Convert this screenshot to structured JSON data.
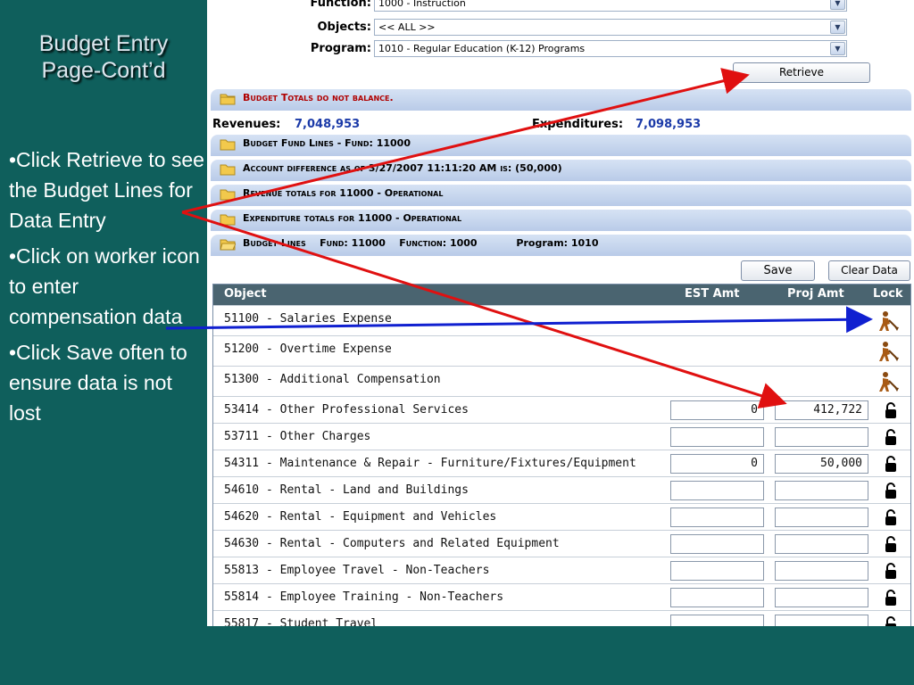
{
  "slide": {
    "title_line1": "Budget Entry",
    "title_line2": "Page-Cont’d",
    "bullets": [
      "•Click Retrieve to see the Budget Lines for Data Entry",
      "•Click on worker icon to enter compensation data",
      "•Click Save often to ensure data is not lost"
    ]
  },
  "filters": {
    "function": {
      "label": "Function:",
      "value": "1000 - Instruction"
    },
    "objects": {
      "label": "Objects:",
      "value": "<< ALL >>"
    },
    "program": {
      "label": "Program:",
      "value": "1010 - Regular Education (K-12) Programs"
    }
  },
  "buttons": {
    "retrieve": "Retrieve",
    "save": "Save",
    "clear_data": "Clear Data"
  },
  "sections": {
    "warning": "Budget Totals do not balance.",
    "fund_lines": "Budget Fund Lines - Fund: 11000",
    "account_difference": "Account difference as of 3/27/2007 11:11:20 AM is: (50,000)",
    "revenue_totals": "Revenue totals for 11000 - Operational",
    "expenditure_totals": "Expenditure totals for 11000 - Operational",
    "budget_lines": "Budget Lines    Fund: 11000    Function: 1000",
    "budget_lines_program": "Program: 1010"
  },
  "totals": {
    "revenues_label": "Revenues:",
    "revenues_value": "7,048,953",
    "expenditures_label": "Expenditures:",
    "expenditures_value": "7,098,953"
  },
  "table": {
    "headers": {
      "object": "Object",
      "est": "EST Amt",
      "proj": "Proj Amt",
      "lock": "Lock"
    },
    "rows": [
      {
        "object": "51100 - Salaries Expense",
        "type": "worker"
      },
      {
        "object": "51200 - Overtime Expense",
        "type": "worker"
      },
      {
        "object": "51300 - Additional Compensation",
        "type": "worker"
      },
      {
        "object": "53414 - Other Professional Services",
        "type": "input",
        "est": "0",
        "proj": "412,722"
      },
      {
        "object": "53711 - Other Charges",
        "type": "input",
        "est": "",
        "proj": ""
      },
      {
        "object": "54311 - Maintenance & Repair - Furniture/Fixtures/Equipment",
        "type": "input",
        "est": "0",
        "proj": "50,000"
      },
      {
        "object": "54610 - Rental - Land and Buildings",
        "type": "input",
        "est": "",
        "proj": ""
      },
      {
        "object": "54620 - Rental - Equipment and Vehicles",
        "type": "input",
        "est": "",
        "proj": ""
      },
      {
        "object": "54630 - Rental - Computers and Related Equipment",
        "type": "input",
        "est": "",
        "proj": ""
      },
      {
        "object": "55813 - Employee Travel - Non-Teachers",
        "type": "input",
        "est": "",
        "proj": ""
      },
      {
        "object": "55814 - Employee Training - Non-Teachers",
        "type": "input",
        "est": "",
        "proj": ""
      },
      {
        "object": "55817 - Student Travel",
        "type": "input",
        "est": "",
        "proj": ""
      }
    ]
  },
  "colors": {
    "slide_background": "#0f5f5c",
    "warning_text": "#b00000",
    "totals_value": "#1b3aa8",
    "arrow_red": "#e01010",
    "arrow_blue": "#1020d0"
  }
}
